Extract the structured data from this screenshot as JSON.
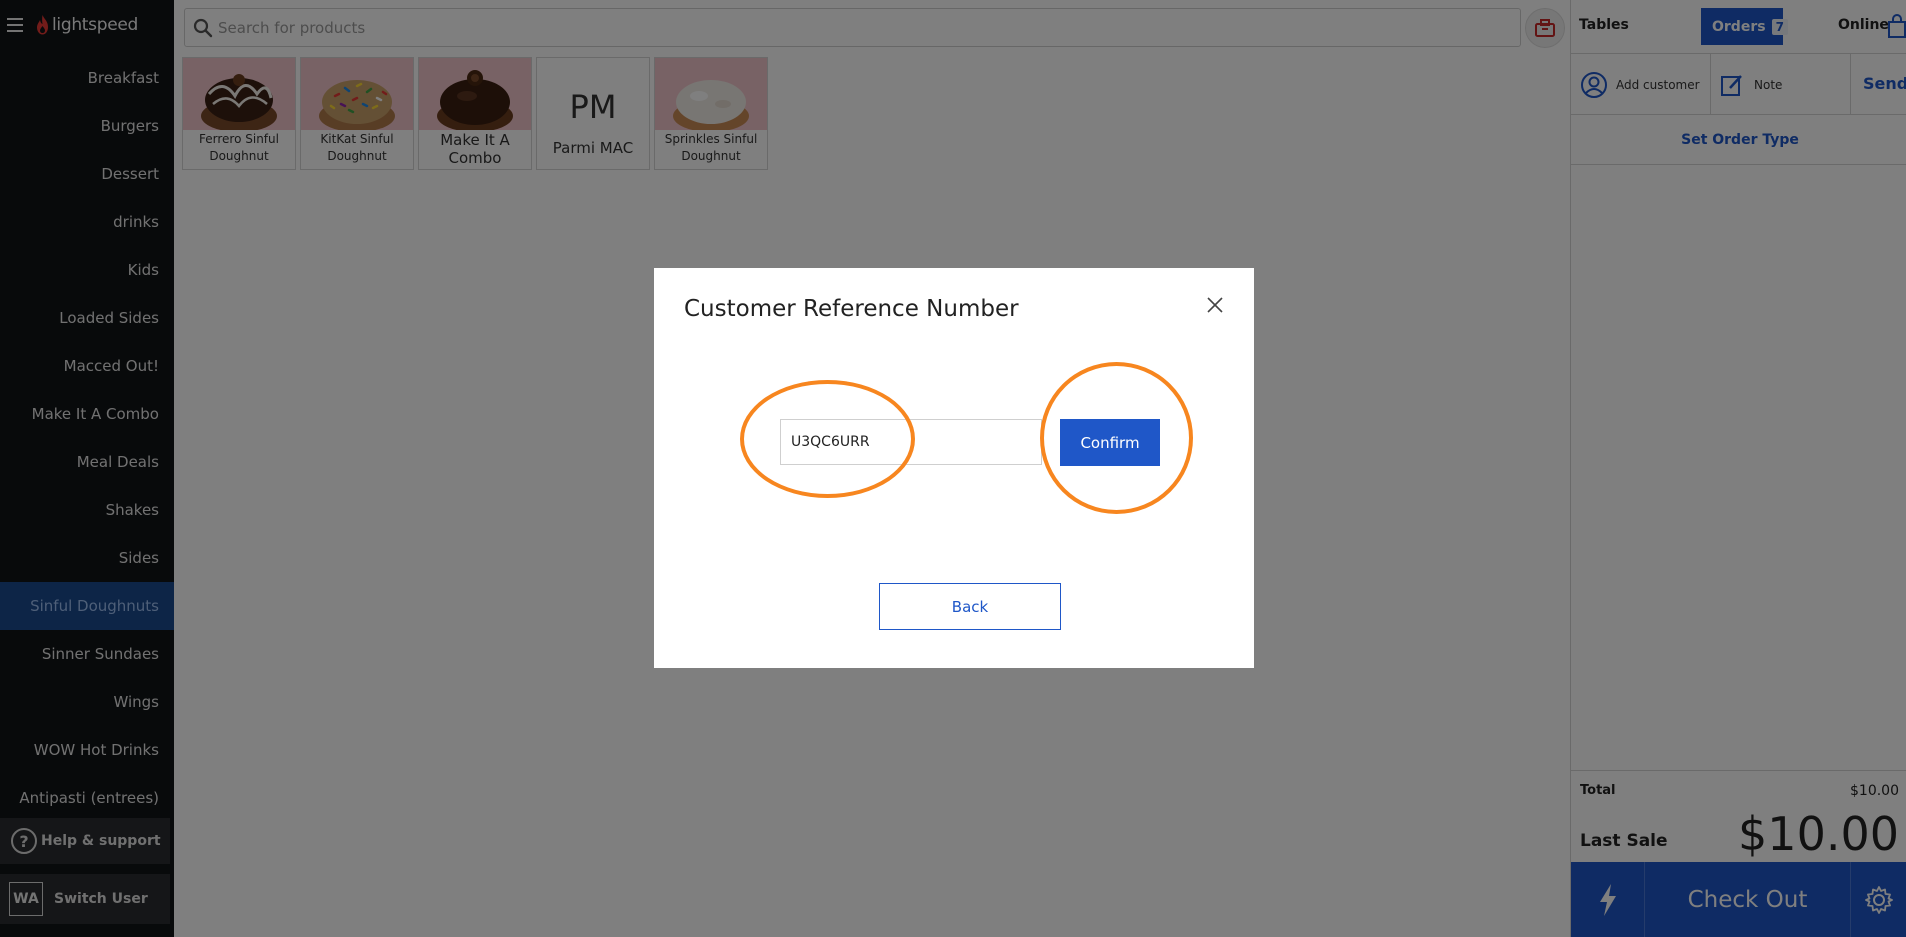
{
  "brand": {
    "name": "lightspeed",
    "accent": "#1f57c8",
    "flame_color": "#e53935"
  },
  "search": {
    "placeholder": "Search for products"
  },
  "sidebar": {
    "categories": [
      {
        "label": "Breakfast",
        "active": false
      },
      {
        "label": "Burgers",
        "active": false
      },
      {
        "label": "Dessert",
        "active": false
      },
      {
        "label": "drinks",
        "active": false
      },
      {
        "label": "Kids",
        "active": false
      },
      {
        "label": "Loaded Sides",
        "active": false
      },
      {
        "label": "Macced Out!",
        "active": false
      },
      {
        "label": "Make It A Combo",
        "active": false
      },
      {
        "label": "Meal Deals",
        "active": false
      },
      {
        "label": "Shakes",
        "active": false
      },
      {
        "label": "Sides",
        "active": false
      },
      {
        "label": "Sinful Doughnuts",
        "active": true
      },
      {
        "label": "Sinner Sundaes",
        "active": false
      },
      {
        "label": "Wings",
        "active": false
      },
      {
        "label": "WOW Hot Drinks",
        "active": false
      },
      {
        "label": "Antipasti (entrees)",
        "active": false
      }
    ],
    "help_label": "Help & support",
    "user_initials": "WA",
    "switch_user_label": "Switch User"
  },
  "products": [
    {
      "name": "Ferrero Sinful Doughnut",
      "image": "chocolate-drizzle-doughnut"
    },
    {
      "name": "KitKat Sinful Doughnut",
      "image": "sprinkle-doughnut"
    },
    {
      "name": "Make It A Combo",
      "image": "chocolate-glazed-doughnut"
    },
    {
      "name": "Parmi MAC",
      "initials": "PM"
    },
    {
      "name": "Sprinkles Sinful Doughnut",
      "image": "white-glazed-doughnut"
    }
  ],
  "order_panel": {
    "tabs": {
      "tables": "Tables",
      "orders": "Orders",
      "orders_count": "7",
      "online": "Online"
    },
    "add_customer_label": "Add customer",
    "note_label": "Note",
    "send_label": "Send",
    "order_type_label": "Set Order Type",
    "total_label": "Total",
    "total_value": "$10.00",
    "last_sale_label": "Last Sale",
    "last_sale_value": "$10.00",
    "checkout_label": "Check Out"
  },
  "modal": {
    "title": "Customer Reference Number",
    "input_value": "U3QC6URR",
    "confirm_label": "Confirm",
    "back_label": "Back",
    "highlight_color": "#f7861f"
  }
}
